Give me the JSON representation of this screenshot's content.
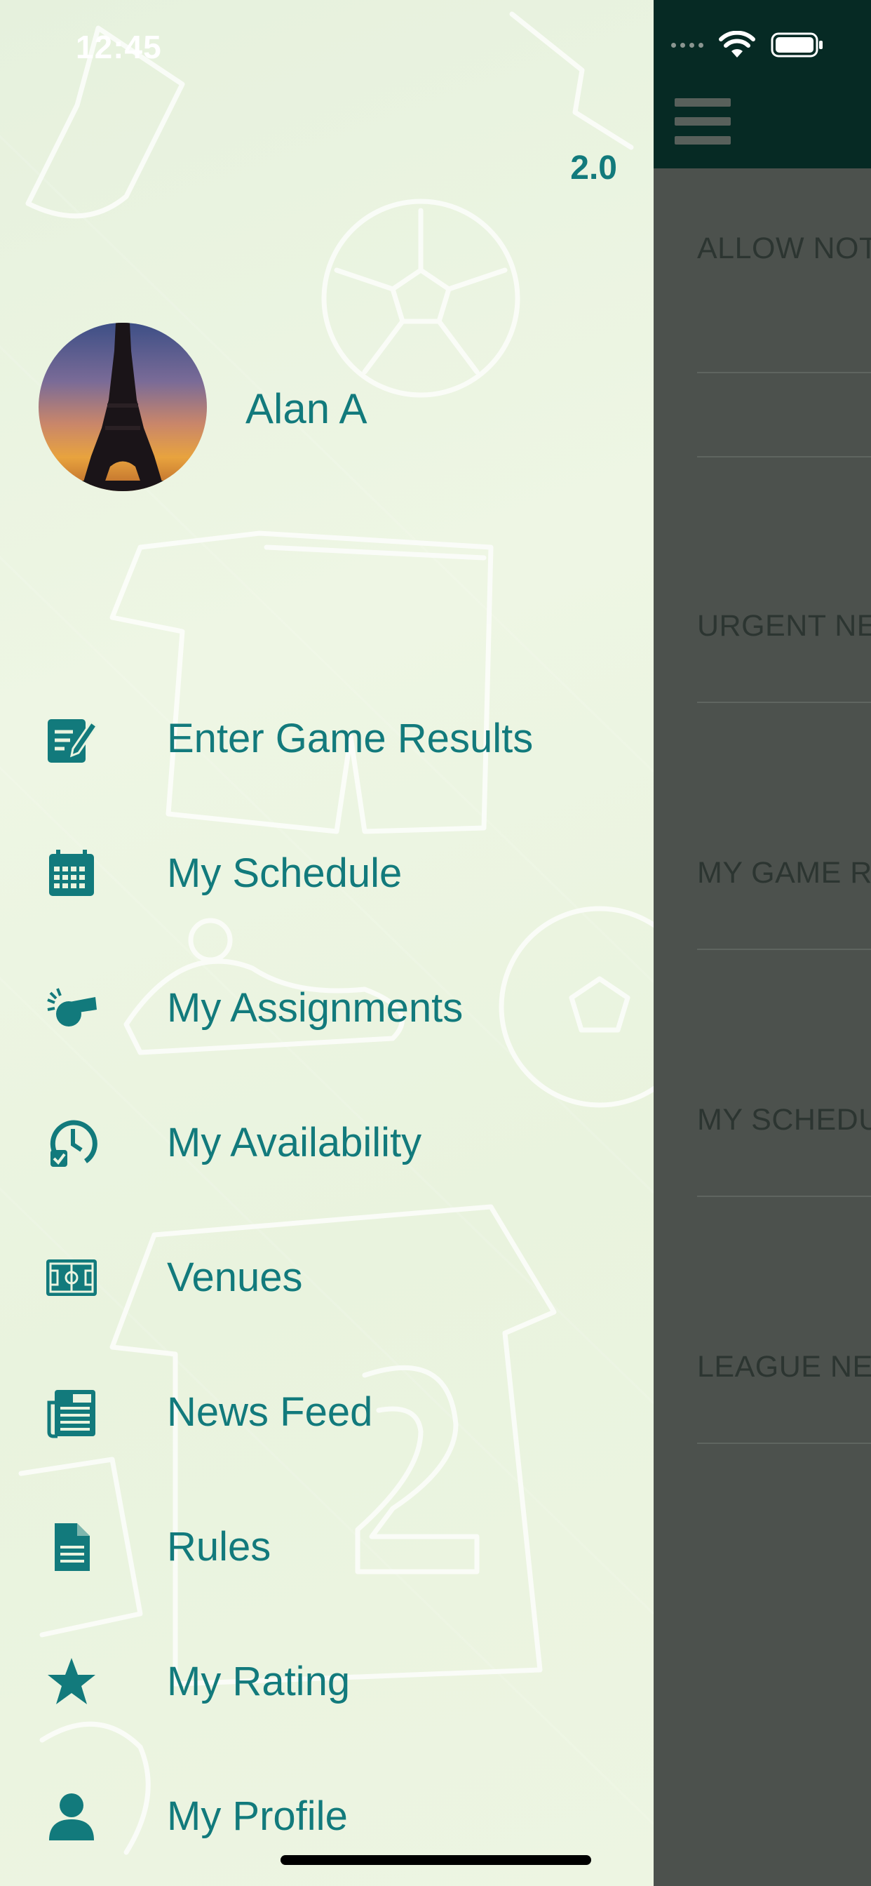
{
  "status_bar": {
    "time": "12:45"
  },
  "drawer": {
    "version": "2.0",
    "user_name": "Alan A",
    "menu": [
      {
        "label": "Enter Game Results",
        "icon": "edit-document-icon"
      },
      {
        "label": "My Schedule",
        "icon": "calendar-icon"
      },
      {
        "label": "My Assignments",
        "icon": "whistle-icon"
      },
      {
        "label": "My Availability",
        "icon": "availability-clock-icon"
      },
      {
        "label": "Venues",
        "icon": "soccer-field-icon"
      },
      {
        "label": "News Feed",
        "icon": "newspaper-icon"
      },
      {
        "label": "Rules",
        "icon": "document-icon"
      },
      {
        "label": "My Rating",
        "icon": "star-icon"
      },
      {
        "label": "My Profile",
        "icon": "person-icon"
      }
    ]
  },
  "main": {
    "rows": [
      {
        "label": "ALLOW NOT"
      },
      {
        "label": ""
      },
      {
        "label": "URGENT NE"
      },
      {
        "label": "MY GAME R"
      },
      {
        "label": "MY SCHEDU"
      },
      {
        "label": "LEAGUE NE"
      }
    ]
  },
  "colors": {
    "accent": "#127a7c",
    "drawer_bg": "#eaf4e0",
    "topbar": "#062a24",
    "overlay": "#4c514d"
  }
}
